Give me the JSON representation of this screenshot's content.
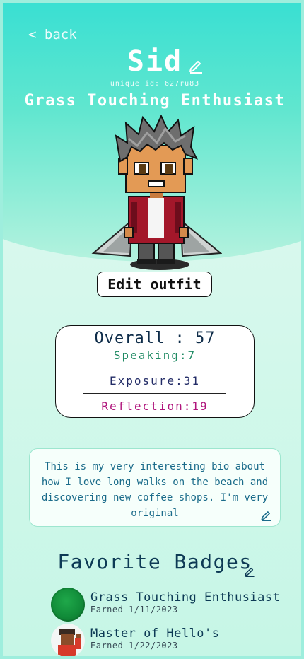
{
  "nav": {
    "back_label": "< back"
  },
  "profile": {
    "name": "Sid",
    "unique_id": "unique id: 627ru83",
    "title": "Grass Touching Enthusiast"
  },
  "avatar": {
    "edit_outfit_label": "Edit outfit"
  },
  "scores": {
    "overall": "Overall : 57",
    "speaking": "Speaking:7",
    "exposure": "Exposure:31",
    "reflection": "Reflection:19"
  },
  "bio": {
    "text": "This is my very interesting bio about how I love long walks on the beach and discovering new coffee shops. I'm very original"
  },
  "badges": {
    "heading": "Favorite Badges",
    "items": [
      {
        "name": "Grass Touching Enthusiast",
        "earned": "Earned 1/11/2023",
        "icon": "grass-badge-icon"
      },
      {
        "name": "Master of Hello's",
        "earned": "Earned 1/22/2023",
        "icon": "waving-avatar-badge-icon"
      }
    ]
  },
  "colors": {
    "header_top": "#1bdad5",
    "header_bottom": "#b4f2de",
    "speaking": "#1f8a63",
    "exposure": "#222b66",
    "reflection": "#b0157c",
    "heading": "#0d3a55"
  }
}
